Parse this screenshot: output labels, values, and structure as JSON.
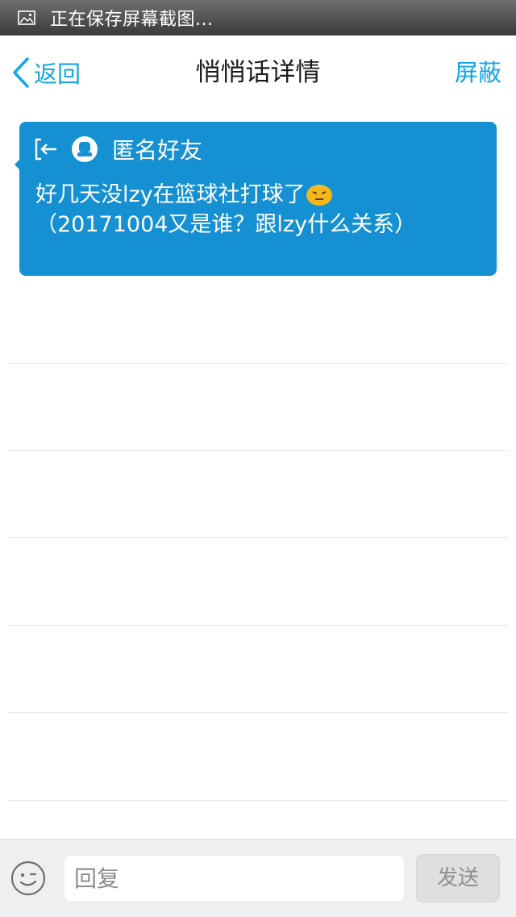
{
  "status_bar": {
    "icon": "image-icon",
    "text": "正在保存屏幕截图..."
  },
  "nav": {
    "back_icon": "chevron-left-icon",
    "back_label": "返回",
    "title": "悄悄话详情",
    "block_label": "屏蔽"
  },
  "message": {
    "exit_icon": "exit-arrow-icon",
    "avatar_icon": "anonymous-avatar-icon",
    "sender": "匿名好友",
    "line1": "好几天没lzy在篮球社打球了",
    "emoji": "pouting-face-emoji",
    "line2": "（20171004又是谁？跟lzy什么关系）"
  },
  "reply_bar": {
    "emoji_button_icon": "smiley-icon",
    "input_placeholder": "回复",
    "input_value": "",
    "send_label": "发送"
  },
  "colors": {
    "accent": "#12a5e6",
    "bubble": "#1590d3",
    "bottom_bar": "#edeff1"
  }
}
